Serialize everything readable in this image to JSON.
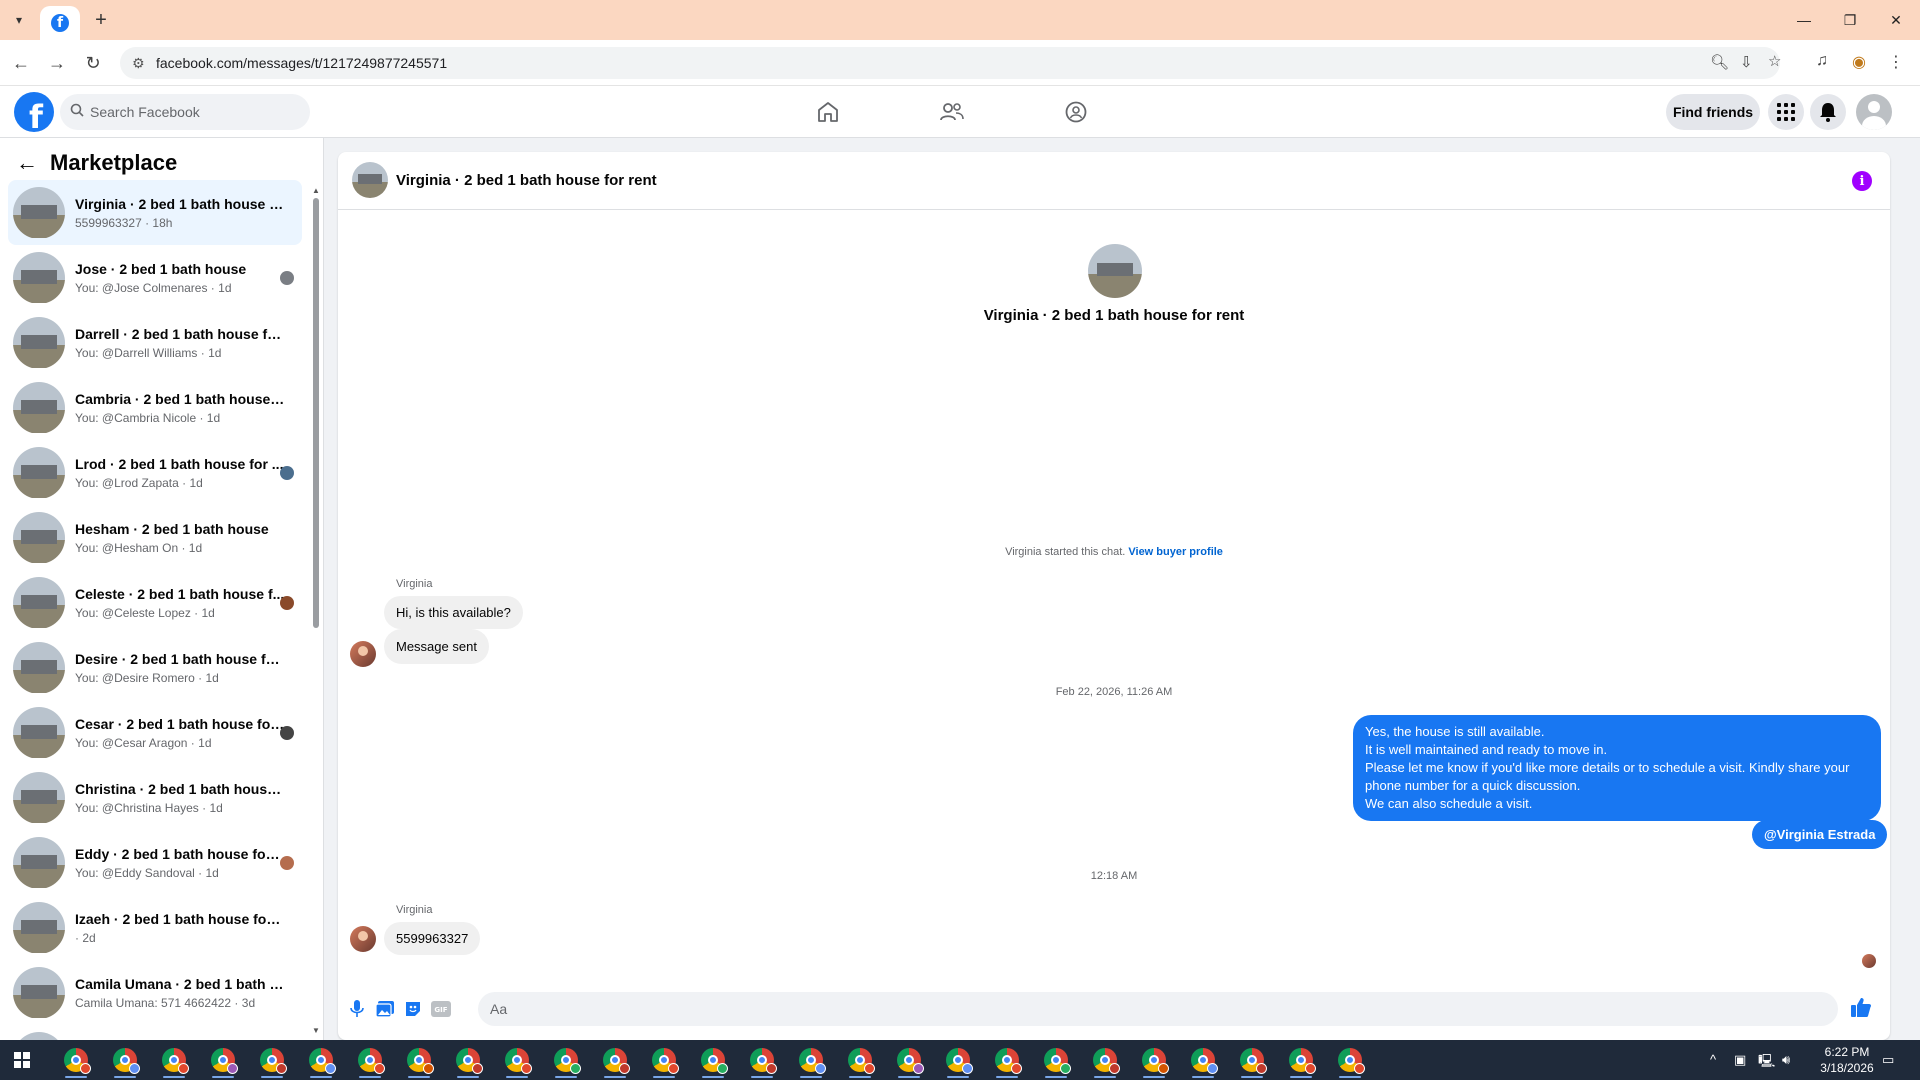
{
  "browser": {
    "url": "facebook.com/messages/t/1217249877245571",
    "tab_title": "Facebook"
  },
  "header": {
    "search_placeholder": "Search Facebook",
    "find_friends": "Find friends",
    "nav": [
      "home-icon",
      "friends-icon",
      "groups-icon"
    ]
  },
  "sidebar": {
    "title": "Marketplace",
    "conversations": [
      {
        "name": "Virginia · 2 bed 1 bath house for...",
        "sub": "5599963327 · 18h",
        "active": true
      },
      {
        "name": "Jose · 2 bed 1 bath house",
        "sub": "You: @Jose Colmenares · 1d"
      },
      {
        "name": "Darrell · 2 bed 1 bath house for r...",
        "sub": "You: @Darrell Williams · 1d"
      },
      {
        "name": "Cambria · 2 bed 1 bath house fo...",
        "sub": "You: @Cambria Nicole · 1d"
      },
      {
        "name": "Lrod · 2 bed 1 bath house for ...",
        "sub": "You: @Lrod Zapata · 1d"
      },
      {
        "name": "Hesham · 2 bed 1 bath house",
        "sub": "You: @Hesham On · 1d"
      },
      {
        "name": "Celeste · 2 bed 1 bath house f...",
        "sub": "You: @Celeste Lopez · 1d"
      },
      {
        "name": "Desire · 2 bed 1 bath house for r...",
        "sub": "You: @Desire Romero · 1d"
      },
      {
        "name": "Cesar · 2 bed 1 bath house for...",
        "sub": "You: @Cesar Aragon · 1d"
      },
      {
        "name": "Christina · 2 bed 1 bath house fo...",
        "sub": "You: @Christina Hayes · 1d"
      },
      {
        "name": "Eddy · 2 bed 1 bath house for ...",
        "sub": "You: @Eddy Sandoval · 1d"
      },
      {
        "name": "Izaeh · 2 bed 1 bath house for re...",
        "sub": " · 2d"
      },
      {
        "name": "Camila Umana · 2 bed 1 bath ho...",
        "sub": "Camila Umana: 571 4662422 · 3d"
      },
      {
        "name": "",
        "sub": ""
      }
    ]
  },
  "chat": {
    "title": "Virginia · 2 bed 1 bath house for rent",
    "intro_title": "Virginia · 2 bed 1 bath house for rent",
    "started_text": "Virginia started this chat.",
    "view_profile": "View buyer profile",
    "sender": "Virginia",
    "msg1": "Hi, is this available?",
    "msg2": "Message sent",
    "timestamp1": "Feb 22, 2026, 11:26 AM",
    "reply_lines": [
      "Yes, the house is still available.",
      "It is well maintained and ready to move in.",
      "Please let me know if you'd like more details or to schedule a visit. Kindly share your",
      "phone number for a quick discussion.",
      "We can also schedule a visit."
    ],
    "mention": "@Virginia Estrada",
    "timestamp2": "12:18 AM",
    "sender2": "Virginia",
    "msg3": "5599963327",
    "composer_placeholder": "Aa"
  },
  "taskbar": {
    "time": "6:22 PM",
    "date": "3/18/2026"
  },
  "colors": {
    "accent": "#1877f2",
    "tabbar": "#fbd7c1",
    "taskbar": "#1f2a3a"
  }
}
